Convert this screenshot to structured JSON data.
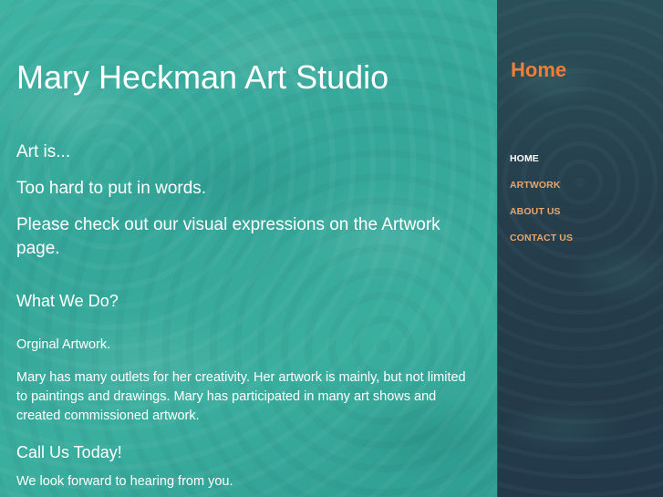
{
  "header": {
    "site_title": "Mary Heckman Art Studio"
  },
  "intro": {
    "line1": "Art is...",
    "line2": "Too hard to put in words.",
    "line3": "Please check out our visual expressions on the Artwork page."
  },
  "what_we_do": {
    "heading": "What We Do?",
    "para1": "Orginal Artwork.",
    "para2": "Mary has many outlets for her creativity. Her artwork is mainly, but not limited to paintings and drawings. Mary has participated in many art shows and created commissioned artwork."
  },
  "call_us": {
    "heading": "Call Us Today!",
    "para1": "We look forward to hearing from you."
  },
  "sidebar": {
    "current_page": "Home",
    "nav_items": [
      {
        "label": "HOME",
        "active": true
      },
      {
        "label": "ARTWORK",
        "active": false
      },
      {
        "label": "ABOUT US",
        "active": false
      },
      {
        "label": "CONTACT US",
        "active": false
      }
    ]
  },
  "colors": {
    "main_bg": "#3aae9f",
    "sidebar_bg": "#263f4c",
    "accent": "#f07e3a",
    "nav_link": "#e8a56e",
    "text": "#ffffff"
  }
}
